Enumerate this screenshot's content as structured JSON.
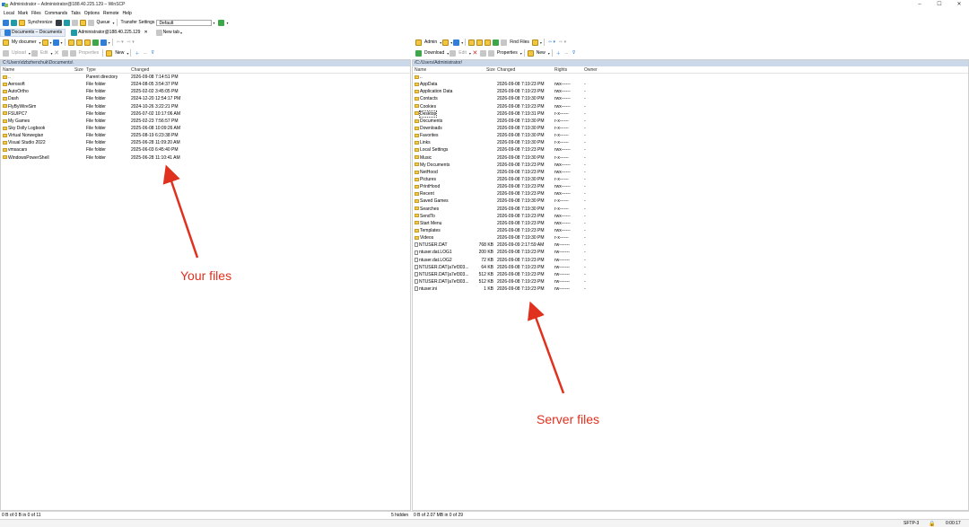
{
  "window": {
    "title": "Administrator – Administrator@188.40.225.129 – WinSCP",
    "controls": [
      "–",
      "☐",
      "✕"
    ]
  },
  "menubar": [
    "Local",
    "Mark",
    "Files",
    "Commands",
    "Tabs",
    "Options",
    "Remote",
    "Help"
  ],
  "toolbar": {
    "synchronize": "Synchronize",
    "queue": "Queue",
    "transfer_settings": "Transfer Settings",
    "transfer_value": "Default"
  },
  "tabs": [
    {
      "label": "Documents – Documents"
    },
    {
      "label": "Administrator@188.40.225.129"
    },
    {
      "label": "New tab"
    }
  ],
  "local": {
    "location": "My documer",
    "upload": "Upload",
    "edit": "Edit",
    "properties": "Properties",
    "new": "New",
    "path": "C:\\Users\\dzbzhenchuk\\Documents\\",
    "columns": [
      "Name",
      "Size",
      "Type",
      "Changed"
    ],
    "files": [
      {
        "name": "..",
        "size": "",
        "type": "Parent directory",
        "changed": "2026-09-08 7:14:51 PM",
        "kind": "parent"
      },
      {
        "name": "Aerosoft",
        "size": "",
        "type": "File folder",
        "changed": "2024-08-05 3:54:37 PM",
        "kind": "folder"
      },
      {
        "name": "AutoOrtho",
        "size": "",
        "type": "File folder",
        "changed": "2025-02-02 3:45:05 PM",
        "kind": "folder"
      },
      {
        "name": "Dash",
        "size": "",
        "type": "File folder",
        "changed": "2024-12-20 12:54:17 PM",
        "kind": "folder"
      },
      {
        "name": "FlyByWireSim",
        "size": "",
        "type": "File folder",
        "changed": "2024-10-26 3:22:21 PM",
        "kind": "folder"
      },
      {
        "name": "FSUIPC7",
        "size": "",
        "type": "File folder",
        "changed": "2026-07-02 10:17:06 AM",
        "kind": "folder"
      },
      {
        "name": "My Games",
        "size": "",
        "type": "File folder",
        "changed": "2025-02-23 7:56:57 PM",
        "kind": "folder"
      },
      {
        "name": "Sky Dolly Logbook",
        "size": "",
        "type": "File folder",
        "changed": "2025-06-08 10:09:26 AM",
        "kind": "folder"
      },
      {
        "name": "Virtual Norwegian",
        "size": "",
        "type": "File folder",
        "changed": "2025-08-19 6:23:38 PM",
        "kind": "folder"
      },
      {
        "name": "Visual Studio 2022",
        "size": "",
        "type": "File folder",
        "changed": "2025-06-28 11:09:20 AM",
        "kind": "folder"
      },
      {
        "name": "vmsacars",
        "size": "",
        "type": "File folder",
        "changed": "2025-06-03 6:45:40 PM",
        "kind": "folder"
      },
      {
        "name": "WindowsPowerShell",
        "size": "",
        "type": "File folder",
        "changed": "2025-06-28 11:10:41 AM",
        "kind": "folder"
      }
    ],
    "status": "0 B of 0 B in 0 of 11",
    "hidden": "5 hidden"
  },
  "remote": {
    "location": "Admin",
    "download": "Download",
    "edit": "Edit",
    "properties": "Properties",
    "new": "New",
    "find_files": "Find Files",
    "path": "/C:/Users/Administrator/",
    "columns": [
      "Name",
      "Size",
      "Changed",
      "Rights",
      "Owner"
    ],
    "files": [
      {
        "name": "..",
        "size": "",
        "changed": "",
        "rights": "",
        "owner": "",
        "kind": "parent"
      },
      {
        "name": "AppData",
        "size": "",
        "changed": "2026-09-08 7:19:23 PM",
        "rights": "rwx------",
        "owner": "-",
        "kind": "folder"
      },
      {
        "name": "Application Data",
        "size": "",
        "changed": "2026-09-08 7:19:23 PM",
        "rights": "rwx------",
        "owner": "-",
        "kind": "folder"
      },
      {
        "name": "Contacts",
        "size": "",
        "changed": "2026-09-08 7:19:30 PM",
        "rights": "rwx------",
        "owner": "-",
        "kind": "folder"
      },
      {
        "name": "Cookies",
        "size": "",
        "changed": "2026-09-08 7:19:23 PM",
        "rights": "rwx------",
        "owner": "-",
        "kind": "folder"
      },
      {
        "name": "Desktop",
        "size": "",
        "changed": "2026-09-08 7:19:31 PM",
        "rights": "r-x------",
        "owner": "-",
        "kind": "folder",
        "focus": true
      },
      {
        "name": "Documents",
        "size": "",
        "changed": "2026-09-08 7:19:30 PM",
        "rights": "r-x------",
        "owner": "-",
        "kind": "folder"
      },
      {
        "name": "Downloads",
        "size": "",
        "changed": "2026-09-08 7:19:30 PM",
        "rights": "r-x------",
        "owner": "-",
        "kind": "folder"
      },
      {
        "name": "Favorites",
        "size": "",
        "changed": "2026-09-08 7:19:30 PM",
        "rights": "r-x------",
        "owner": "-",
        "kind": "folder"
      },
      {
        "name": "Links",
        "size": "",
        "changed": "2026-09-08 7:19:30 PM",
        "rights": "r-x------",
        "owner": "-",
        "kind": "folder"
      },
      {
        "name": "Local Settings",
        "size": "",
        "changed": "2026-09-08 7:19:23 PM",
        "rights": "rwx------",
        "owner": "-",
        "kind": "folder"
      },
      {
        "name": "Music",
        "size": "",
        "changed": "2026-09-08 7:19:30 PM",
        "rights": "r-x------",
        "owner": "-",
        "kind": "folder"
      },
      {
        "name": "My Documents",
        "size": "",
        "changed": "2026-09-08 7:19:23 PM",
        "rights": "rwx------",
        "owner": "-",
        "kind": "folder"
      },
      {
        "name": "NetHood",
        "size": "",
        "changed": "2026-09-08 7:19:23 PM",
        "rights": "rwx------",
        "owner": "-",
        "kind": "folder"
      },
      {
        "name": "Pictures",
        "size": "",
        "changed": "2026-09-08 7:19:30 PM",
        "rights": "r-x------",
        "owner": "-",
        "kind": "folder"
      },
      {
        "name": "PrintHood",
        "size": "",
        "changed": "2026-09-08 7:19:23 PM",
        "rights": "rwx------",
        "owner": "-",
        "kind": "folder"
      },
      {
        "name": "Recent",
        "size": "",
        "changed": "2026-09-08 7:19:23 PM",
        "rights": "rwx------",
        "owner": "-",
        "kind": "folder"
      },
      {
        "name": "Saved Games",
        "size": "",
        "changed": "2026-09-08 7:19:30 PM",
        "rights": "r-x------",
        "owner": "-",
        "kind": "folder"
      },
      {
        "name": "Searches",
        "size": "",
        "changed": "2026-09-08 7:19:30 PM",
        "rights": "r-x------",
        "owner": "-",
        "kind": "folder"
      },
      {
        "name": "SendTo",
        "size": "",
        "changed": "2026-09-08 7:19:23 PM",
        "rights": "rwx------",
        "owner": "-",
        "kind": "folder"
      },
      {
        "name": "Start Menu",
        "size": "",
        "changed": "2026-09-08 7:19:23 PM",
        "rights": "rwx------",
        "owner": "-",
        "kind": "folder"
      },
      {
        "name": "Templates",
        "size": "",
        "changed": "2026-09-08 7:19:23 PM",
        "rights": "rwx------",
        "owner": "-",
        "kind": "folder"
      },
      {
        "name": "Videos",
        "size": "",
        "changed": "2026-09-08 7:19:30 PM",
        "rights": "r-x------",
        "owner": "-",
        "kind": "folder"
      },
      {
        "name": "NTUSER.DAT",
        "size": "768 KB",
        "changed": "2026-09-09 2:17:59 AM",
        "rights": "rw-------",
        "owner": "-",
        "kind": "file"
      },
      {
        "name": "ntuser.dat.LOG1",
        "size": "200 KB",
        "changed": "2026-09-08 7:19:23 PM",
        "rights": "rw-------",
        "owner": "-",
        "kind": "file"
      },
      {
        "name": "ntuser.dat.LOG2",
        "size": "72 KB",
        "changed": "2026-09-08 7:19:23 PM",
        "rights": "rw-------",
        "owner": "-",
        "kind": "file"
      },
      {
        "name": "NTUSER.DAT{a7ef303...",
        "size": "64 KB",
        "changed": "2026-09-08 7:19:23 PM",
        "rights": "rw-------",
        "owner": "-",
        "kind": "file"
      },
      {
        "name": "NTUSER.DAT{a7ef303...",
        "size": "512 KB",
        "changed": "2026-09-08 7:19:23 PM",
        "rights": "rw-------",
        "owner": "-",
        "kind": "file"
      },
      {
        "name": "NTUSER.DAT{a7ef303...",
        "size": "512 KB",
        "changed": "2026-09-08 7:19:23 PM",
        "rights": "rw-------",
        "owner": "-",
        "kind": "file"
      },
      {
        "name": "ntuser.ini",
        "size": "1 KB",
        "changed": "2026-09-08 7:19:23 PM",
        "rights": "rw-------",
        "owner": "-",
        "kind": "file"
      }
    ],
    "status": "0 B of 2.07 MB in 0 of 29"
  },
  "bottom": {
    "protocol": "SFTP-3",
    "time": "0:00:17"
  },
  "annotations": {
    "left": "Your files",
    "right": "Server files"
  },
  "colors": {
    "accent_path": "#cad8ea",
    "arrow": "#e0301e",
    "folder": "#f2c94c"
  }
}
